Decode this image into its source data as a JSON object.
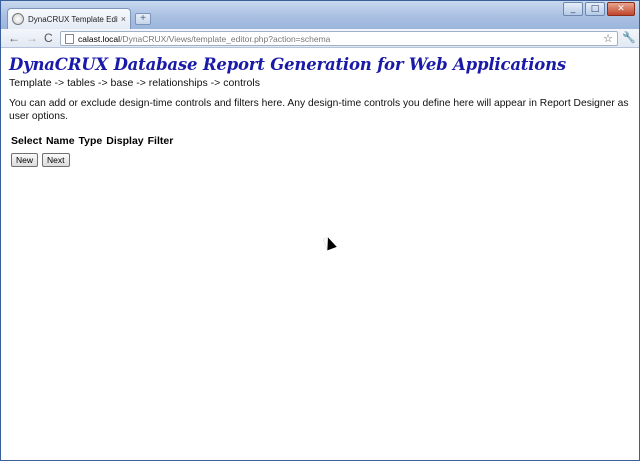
{
  "browser": {
    "tab_title": "DynaCRUX Template Editor",
    "tab_close": "×",
    "new_tab": "+",
    "url_host": "calast.local",
    "url_path": "/DynaCRUX/Views/template_editor.php?action=schema",
    "nav_back": "←",
    "nav_forward": "→",
    "nav_reload": "C",
    "bookmark": "☆",
    "menu": "🔧",
    "win_minimize": "_",
    "win_maximize": "□",
    "win_close": "✕"
  },
  "page": {
    "title": "DynaCRUX Database Report Generation for Web Applications",
    "breadcrumb": "Template -> tables -> base -> relationships -> controls",
    "intro": "You can add or exclude design-time controls and filters here. Any design-time controls you define here will appear in Report Designer as user options.",
    "columns": [
      "Select",
      "Name",
      "Type",
      "Display",
      "Filter"
    ],
    "buttons": {
      "new": "New",
      "next": "Next"
    }
  },
  "icons": {
    "favicon": "globe-icon",
    "page": "page-icon",
    "star": "star-icon",
    "wrench": "wrench-icon"
  },
  "colors": {
    "title": "#1a1aa8",
    "titlebar": "#a9c0e2"
  }
}
